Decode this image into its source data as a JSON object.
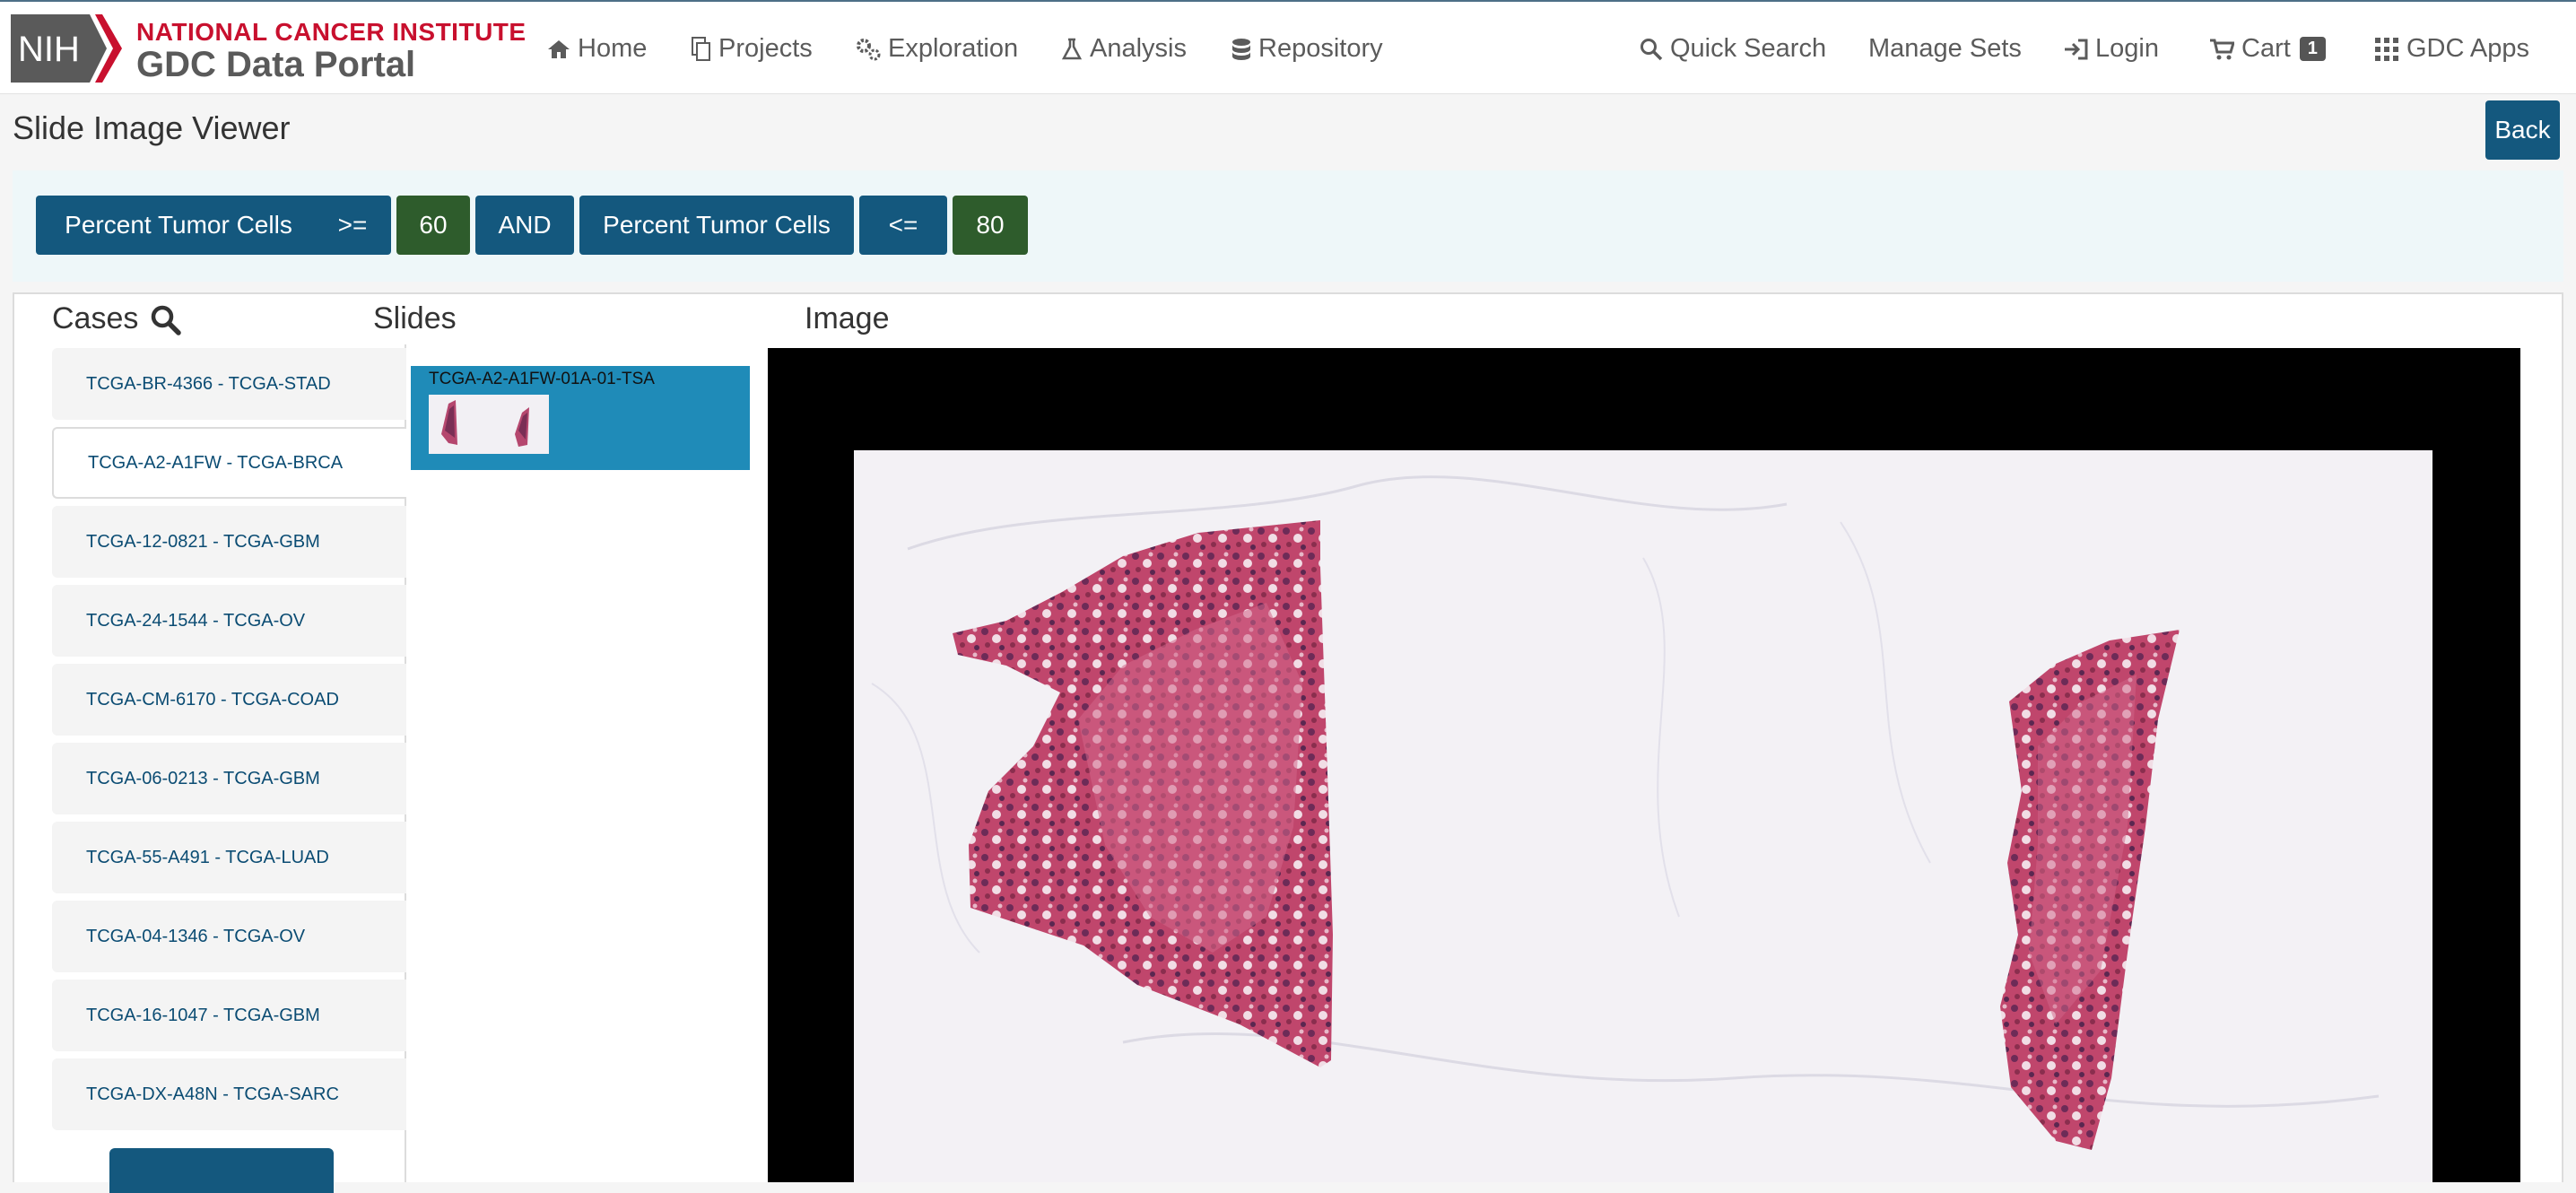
{
  "header": {
    "logo_text": "NIH",
    "brand_top": "NATIONAL CANCER INSTITUTE",
    "brand_bottom": "GDC Data Portal",
    "nav": {
      "home": "Home",
      "projects": "Projects",
      "exploration": "Exploration",
      "analysis": "Analysis",
      "repository": "Repository",
      "quick_search": "Quick Search",
      "manage_sets": "Manage Sets",
      "login": "Login",
      "cart": "Cart",
      "cart_count": "1",
      "gdc_apps": "GDC Apps"
    }
  },
  "page": {
    "title": "Slide Image Viewer",
    "back_label": "Back"
  },
  "filters": [
    {
      "label": "Percent Tumor Cells",
      "color": "#14587e"
    },
    {
      "label": ">=",
      "color": "#14587e"
    },
    {
      "label": "60",
      "color": "#2e5c2c"
    },
    {
      "label": "AND",
      "color": "#14587e"
    },
    {
      "label": "Percent Tumor Cells",
      "color": "#14587e"
    },
    {
      "label": "<=",
      "color": "#14587e"
    },
    {
      "label": "80",
      "color": "#2e5c2c"
    }
  ],
  "columns": {
    "cases": "Cases",
    "slides": "Slides",
    "image": "Image"
  },
  "cases": [
    {
      "label": "TCGA-BR-4366 - TCGA-STAD",
      "active": false
    },
    {
      "label": "TCGA-A2-A1FW - TCGA-BRCA",
      "active": true
    },
    {
      "label": "TCGA-12-0821 - TCGA-GBM",
      "active": false
    },
    {
      "label": "TCGA-24-1544 - TCGA-OV",
      "active": false
    },
    {
      "label": "TCGA-CM-6170 - TCGA-COAD",
      "active": false
    },
    {
      "label": "TCGA-06-0213 - TCGA-GBM",
      "active": false
    },
    {
      "label": "TCGA-55-A491 - TCGA-LUAD",
      "active": false
    },
    {
      "label": "TCGA-04-1346 - TCGA-OV",
      "active": false
    },
    {
      "label": "TCGA-16-1047 - TCGA-GBM",
      "active": false
    },
    {
      "label": "TCGA-DX-A48N - TCGA-SARC",
      "active": false
    }
  ],
  "slides": [
    {
      "label": "TCGA-A2-A1FW-01A-01-TSA",
      "selected": true
    }
  ],
  "colors": {
    "accent": "#14587e",
    "value_chip": "#2e5c2c",
    "slide_selected": "#1f8bb8",
    "nih_red": "#c8102e"
  },
  "icons": {
    "search": "search-icon",
    "home": "home-icon",
    "projects": "copy-icon",
    "exploration": "cogs-icon",
    "analysis": "flask-icon",
    "repository": "database-icon",
    "login": "sign-in-icon",
    "cart": "cart-icon",
    "apps": "grid-icon"
  }
}
